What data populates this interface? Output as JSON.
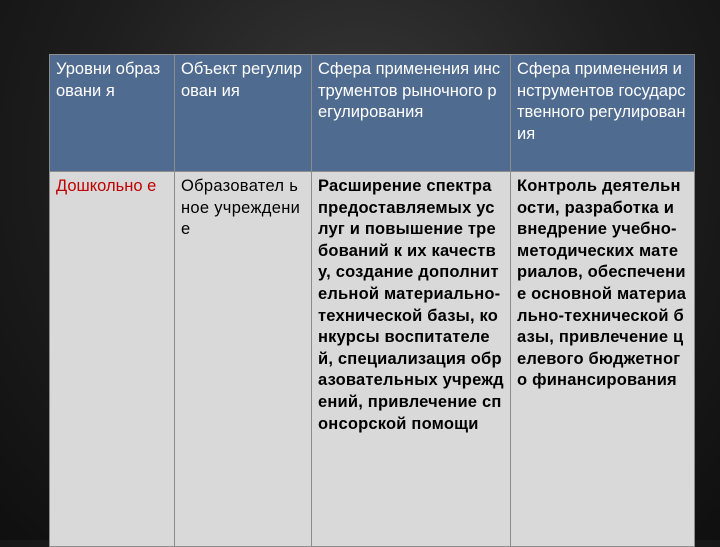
{
  "table": {
    "headers": [
      "Уровни образовани я",
      "Объект регулирован ия",
      "Сфера применения инструментов рыночного регулирования",
      "Сфера применения инструментов государственного регулирования"
    ],
    "rows": [
      {
        "level": "Дошкольно е",
        "object": "Образовател ьное учреждение",
        "market": "Расширение спектра предоставляемых услуг и повышение требований к их качеству, создание дополнительной материально-технической базы, конкурсы воспитателей, специализация образовательных учреждений, привлечение спонсорской помощи",
        "state": "Контроль деятельности, разработка и внедрение учебно-методических материалов, обеспечение основной материально-технической базы, привлечение целевого бюджетного финансирования"
      }
    ]
  },
  "colors": {
    "header_bg": "#4f6b8f",
    "header_text": "#ffffff",
    "body_bg": "#d9d9d9",
    "level_text": "#c00000"
  }
}
